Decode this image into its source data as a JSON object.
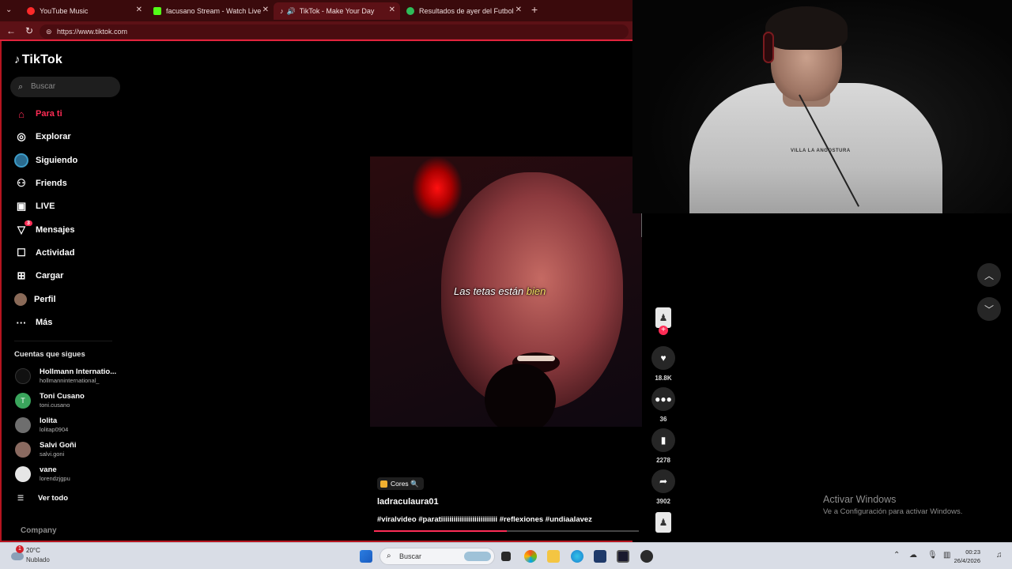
{
  "browser": {
    "tabs": [
      {
        "label": "YouTube Music",
        "color": "#ff2a2a"
      },
      {
        "label": "facusano Stream - Watch Live on K",
        "color": "#53fc18"
      },
      {
        "label": "TikTok - Make Your Day",
        "color": "#111111"
      },
      {
        "label": "Resultados de ayer del Futbol Arg",
        "color": "#2ebd59"
      }
    ],
    "url": "https://www.tiktok.com"
  },
  "tiktok": {
    "brand": "TikTok",
    "search_placeholder": "Buscar",
    "nav": [
      {
        "label": "Para ti",
        "icon": "home-icon",
        "active": true
      },
      {
        "label": "Explorar",
        "icon": "compass-icon"
      },
      {
        "label": "Siguiendo",
        "icon": "following-icon"
      },
      {
        "label": "Friends",
        "icon": "friends-icon"
      },
      {
        "label": "LIVE",
        "icon": "live-icon"
      },
      {
        "label": "Mensajes",
        "icon": "messages-icon",
        "badge": "3"
      },
      {
        "label": "Actividad",
        "icon": "activity-icon"
      },
      {
        "label": "Cargar",
        "icon": "upload-icon"
      },
      {
        "label": "Perfil",
        "icon": "profile-icon"
      },
      {
        "label": "Más",
        "icon": "more-icon"
      }
    ],
    "following_title": "Cuentas que sigues",
    "following": [
      {
        "name": "Hollmann Internatio...",
        "handle": "hollmanninternational_",
        "avatar_initial": "",
        "avatar_color": "#111111"
      },
      {
        "name": "Toni Cusano",
        "handle": "toni.cusano",
        "avatar_initial": "T",
        "avatar_color": "#3aa55c"
      },
      {
        "name": "lolita",
        "handle": "lolitap0904",
        "avatar_initial": "",
        "avatar_color": "#6e6e6e"
      },
      {
        "name": "Salvi Goñi",
        "handle": "salvi.goni",
        "avatar_initial": "",
        "avatar_color": "#8a6a60"
      },
      {
        "name": "vane",
        "handle": "lorendzjgpu",
        "avatar_initial": "",
        "avatar_color": "#e6e6e6"
      }
    ],
    "see_all": "Ver todo",
    "company": "Company",
    "video": {
      "subtitle_main": "Las tetas están ",
      "subtitle_highlight": "bien",
      "chip": "Cores 🔍",
      "author": "ladraculaura01",
      "caption": "#viralvideo #paratiiiiiiiiiiiiiiiiiiiiiiiiiii #reflexiones #undiaalavez",
      "progress": 0.5
    },
    "actions": {
      "likes": "18.8K",
      "comments": "36",
      "saves": "2278",
      "shares": "3902"
    }
  },
  "windows": {
    "activate_title": "Activar Windows",
    "activate_sub": "Ve a Configuración para activar Windows.",
    "weather_temp": "20°C",
    "weather_cond": "Nublado",
    "weather_badge": "1",
    "search": "Buscar",
    "time": "00:23",
    "date": "26/4/2026"
  },
  "webcam": {
    "shirt_text": "VILLA LA ANGOSTURA"
  }
}
